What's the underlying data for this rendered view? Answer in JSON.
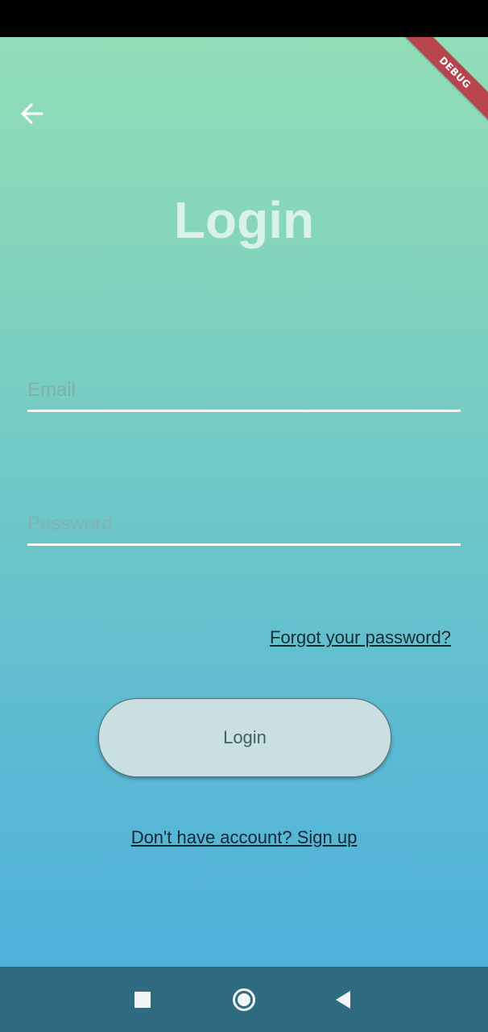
{
  "debug_banner": "DEBUG",
  "header": {
    "back_icon": "arrow-left-icon"
  },
  "page": {
    "title": "Login"
  },
  "form": {
    "email_placeholder": "Email",
    "password_placeholder": "Password",
    "forgot_password": "Forgot your password?",
    "login_button": "Login",
    "signup_link": "Don't have account? Sign up"
  },
  "nav": {
    "recent_icon": "square-icon",
    "home_icon": "circle-icon",
    "back_icon": "triangle-back-icon"
  },
  "colors": {
    "gradient_top": "#91ddb6",
    "gradient_bottom": "#4fb2da",
    "title": "#d8f2e7",
    "button_bg": "#c9dfe2",
    "nav_bar": "#2e6b80",
    "debug_ribbon": "#b8454e"
  }
}
